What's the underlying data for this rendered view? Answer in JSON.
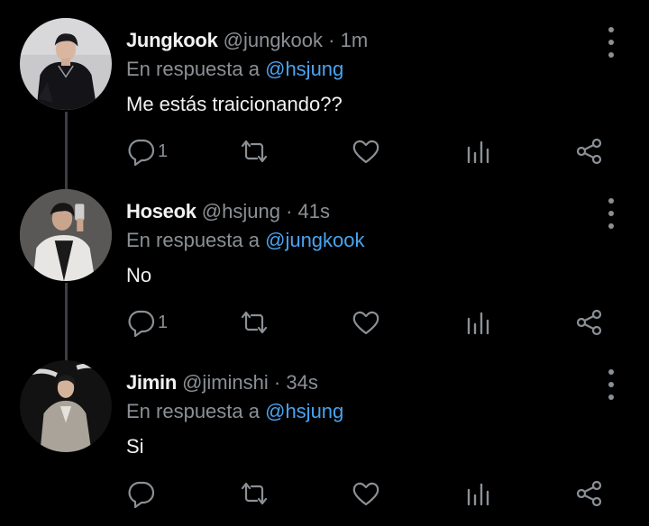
{
  "tweets": [
    {
      "name": "Jungkook",
      "handle": "@jungkook",
      "separator": "·",
      "time": "1m",
      "reply_prefix": "En respuesta a",
      "reply_to": "@hsjung",
      "text": "Me estás traicionando??",
      "reply_count": "1",
      "avatar": "person-dark-outfit-avatar"
    },
    {
      "name": "Hoseok",
      "handle": "@hsjung",
      "separator": "·",
      "time": "41s",
      "reply_prefix": "En respuesta a",
      "reply_to": "@jungkook",
      "text": "No",
      "reply_count": "1",
      "avatar": "person-mirror-selfie-avatar"
    },
    {
      "name": "Jimin",
      "handle": "@jiminshi",
      "separator": "·",
      "time": "34s",
      "reply_prefix": "En respuesta a",
      "reply_to": "@hsjung",
      "text": "Si",
      "reply_count": "",
      "avatar": "person-grey-suit-avatar"
    }
  ],
  "icons": {
    "reply": "reply-icon",
    "retweet": "retweet-icon",
    "like": "heart-icon",
    "views": "analytics-icon",
    "share": "share-icon",
    "menu": "more-vertical-icon"
  },
  "colors": {
    "background": "#000000",
    "text": "#f2f2f2",
    "muted": "#8b9095",
    "mention": "#4aa3f0",
    "thread_line": "#3a3d41"
  }
}
